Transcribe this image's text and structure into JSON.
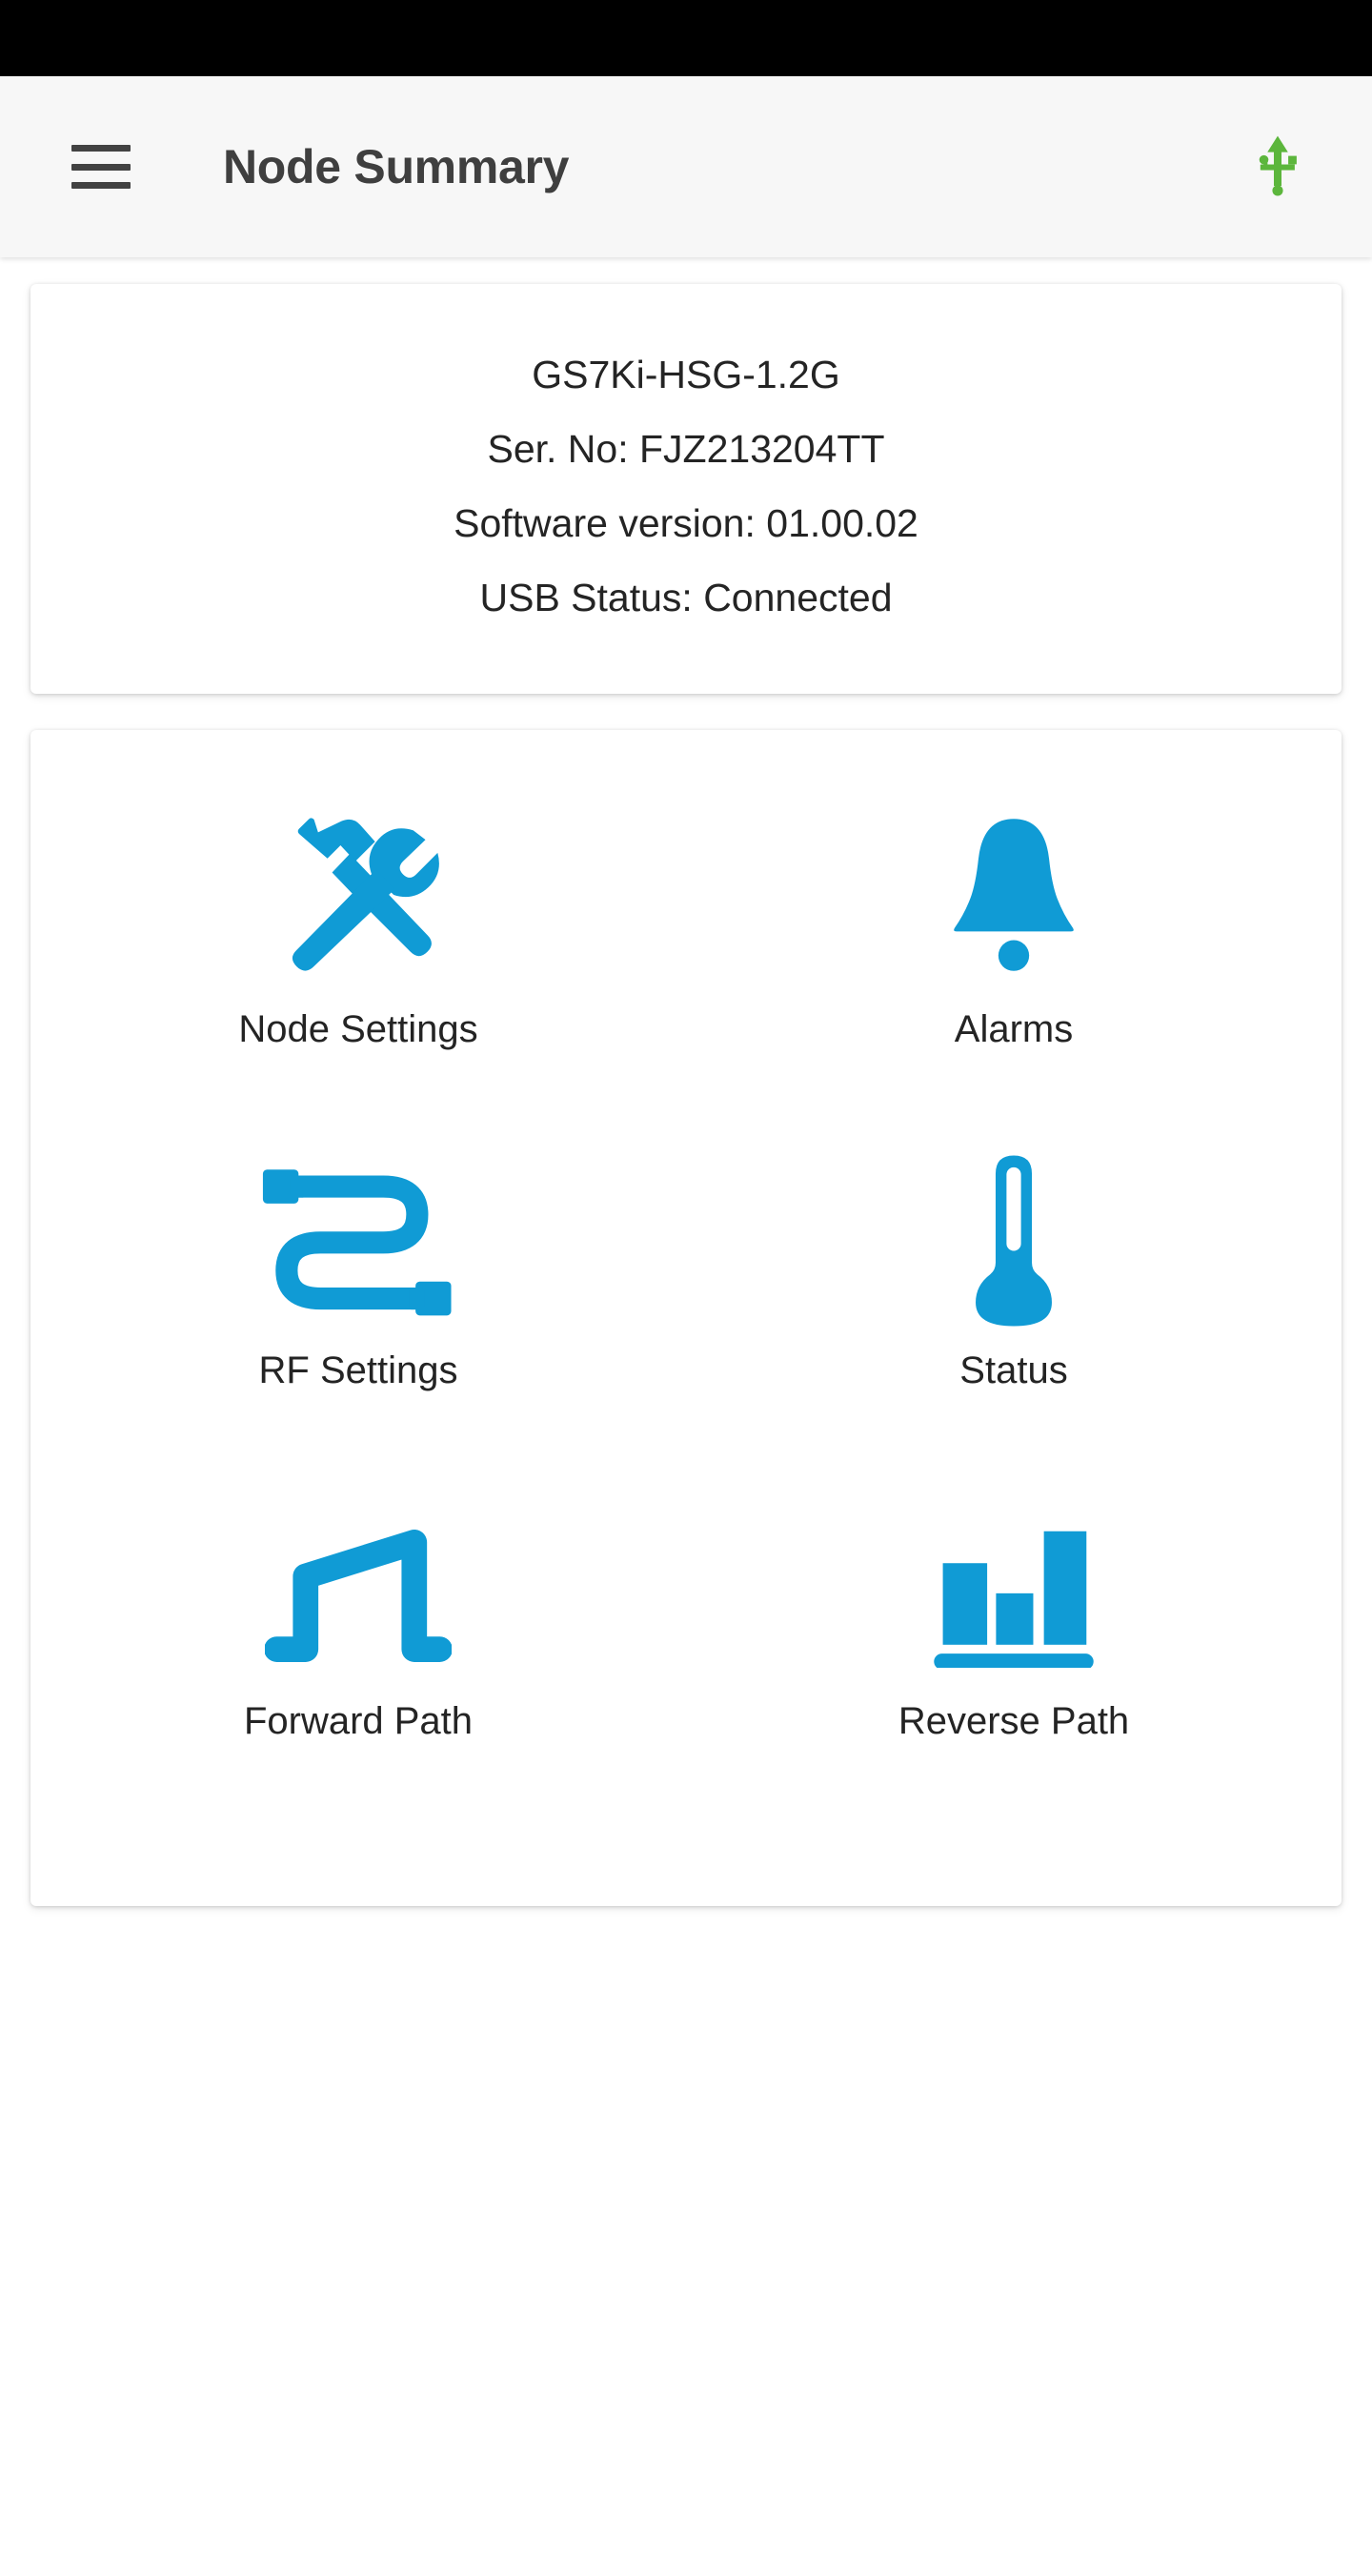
{
  "colors": {
    "accent_blue": "#109BD5",
    "usb_green": "#5CB63C",
    "status_bar": "#000000",
    "app_bar_bg": "#F7F7F7",
    "title_text": "#3F3F3F",
    "body_text": "#242424",
    "page_bg": "#FFFFFF",
    "card_bg": "#FFFFFF"
  },
  "app_bar": {
    "title": "Node Summary",
    "menu_icon": "hamburger-menu-icon",
    "usb_icon": "usb-connected-icon"
  },
  "info_card": {
    "lines": [
      "GS7Ki-HSG-1.2G",
      "Ser. No: FJZ213204TT",
      "Software version: 01.00.02",
      "USB Status: Connected"
    ],
    "model": "GS7Ki-HSG-1.2G",
    "serial_number": "FJZ213204TT",
    "software_version": "01.00.02",
    "usb_status": "Connected"
  },
  "menu": {
    "items": [
      {
        "label": "Node Settings",
        "icon": "hammer-wrench-icon"
      },
      {
        "label": "Alarms",
        "icon": "bell-icon"
      },
      {
        "label": "RF Settings",
        "icon": "rf-cable-icon"
      },
      {
        "label": "Status",
        "icon": "thermometer-icon"
      },
      {
        "label": "Forward Path",
        "icon": "forward-path-signal-icon"
      },
      {
        "label": "Reverse Path",
        "icon": "reverse-path-bar-chart-icon"
      }
    ]
  }
}
